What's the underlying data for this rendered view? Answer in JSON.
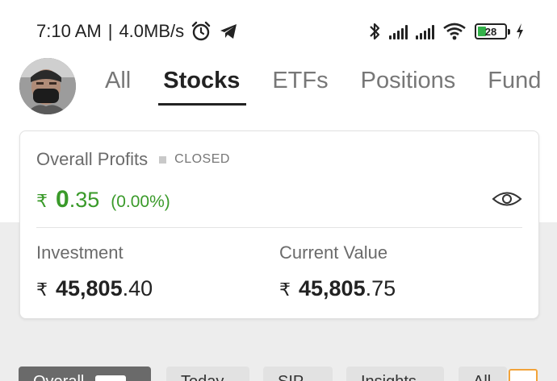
{
  "status_bar": {
    "time": "7:10 AM",
    "separator": "|",
    "speed": "4.0MB/s",
    "battery_level": "28",
    "battery_percent": 28
  },
  "tabs": [
    {
      "label": "All",
      "active": false
    },
    {
      "label": "Stocks",
      "active": true
    },
    {
      "label": "ETFs",
      "active": false
    },
    {
      "label": "Positions",
      "active": false
    },
    {
      "label": "Fund",
      "active": false
    }
  ],
  "summary": {
    "title": "Overall Profits",
    "status": "CLOSED",
    "currency_symbol": "₹",
    "profit_integer": "0",
    "profit_decimal": ".35",
    "profit_percent": "(0.00%)",
    "investment_label": "Investment",
    "investment_integer": "45,805",
    "investment_decimal": ".40",
    "current_label": "Current Value",
    "current_integer": "45,805",
    "current_decimal": ".75"
  },
  "filters": [
    {
      "label": "Overall",
      "active": true
    },
    {
      "label": "Today",
      "active": false
    },
    {
      "label": "SIP",
      "active": false
    },
    {
      "label": "Insights",
      "active": false
    },
    {
      "label": "All",
      "active": false
    }
  ],
  "colors": {
    "profit_green": "#3a9a2a",
    "accent_orange": "#f2a33a",
    "battery_green": "#33b24a"
  }
}
